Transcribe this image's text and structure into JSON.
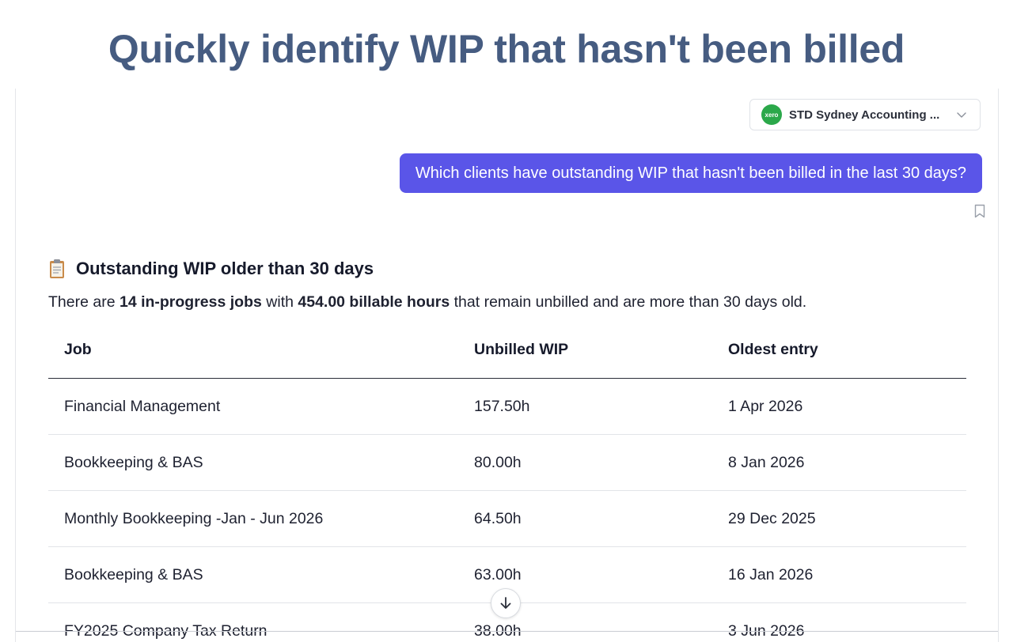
{
  "hero": {
    "title": "Quickly identify WIP that hasn't been billed"
  },
  "org_selector": {
    "logo_text": "xero",
    "org_name": "STD Sydney Accounting ...",
    "icon": "chevron-down-icon",
    "brand_color": "#2ba84a"
  },
  "chat": {
    "user_message": "Which clients have outstanding WIP that hasn't been billed in the last 30 days?",
    "bubble_color": "#5a55e8"
  },
  "answer": {
    "heading_icon": "clipboard-icon",
    "heading": "Outstanding WIP older than 30 days",
    "summary_prefix": "There are ",
    "summary_jobs": "14 in-progress jobs",
    "summary_mid": " with ",
    "summary_hours": "454.00 billable hours",
    "summary_suffix": " that remain unbilled and are more than 30 days old."
  },
  "table": {
    "columns": [
      "Job",
      "Unbilled WIP",
      "Oldest entry"
    ],
    "rows": [
      [
        "Financial Management",
        "157.50h",
        "1 Apr 2026"
      ],
      [
        "Bookkeeping & BAS",
        "80.00h",
        "8 Jan 2026"
      ],
      [
        "Monthly Bookkeeping -Jan - Jun 2026",
        "64.50h",
        "29 Dec 2025"
      ],
      [
        "Bookkeeping & BAS",
        "63.00h",
        "16 Jan 2026"
      ],
      [
        "FY2025 Company Tax Return",
        "38.00h",
        "3 Jun 2026"
      ]
    ]
  },
  "controls": {
    "bookmark_icon": "bookmark-icon",
    "scroll_icon": "arrow-down-icon"
  },
  "theme": {
    "title_color": "#465c81",
    "accent": "#5a55e8"
  }
}
